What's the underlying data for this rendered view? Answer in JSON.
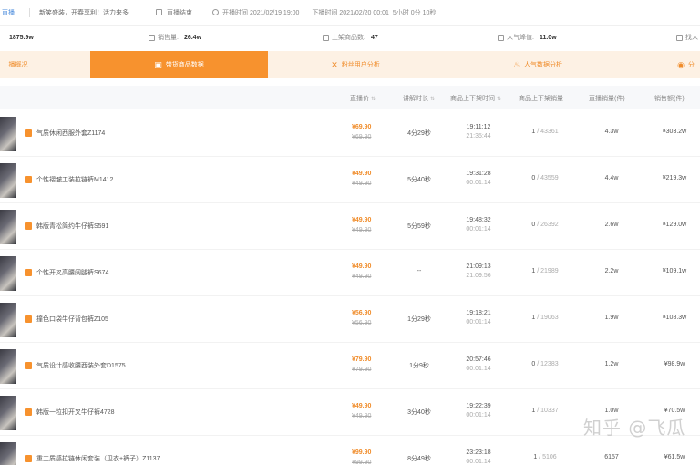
{
  "topbar": {
    "crumb": "直播",
    "slogan": "新笑盛装，开春享利！活力来多",
    "status_label": "直播结束",
    "start_time": "开播时间 2021/02/19 19:00",
    "end_time": "下播时间 2021/02/20 00:01",
    "duration": "5小时 0分 10秒"
  },
  "stats": [
    {
      "label": "",
      "value": "1875.9w"
    },
    {
      "label": "销售量:",
      "value": "26.4w"
    },
    {
      "label": "上架商品数:",
      "value": "47"
    },
    {
      "label": "人气峰值:",
      "value": "11.0w"
    },
    {
      "label": "找人",
      "value": ""
    }
  ],
  "tabs": [
    {
      "label": "播概况",
      "icon": "chart-icon"
    },
    {
      "label": "带货商品数据",
      "icon": "bag-icon"
    },
    {
      "label": "粉丝用户分析",
      "icon": "users-icon"
    },
    {
      "label": "人气数据分析",
      "icon": "fire-icon"
    },
    {
      "label": "分",
      "icon": "coin-icon"
    }
  ],
  "table": {
    "headers": [
      "直播价",
      "讲解时长",
      "商品上下架时间",
      "商品上下架销量",
      "直播销量(件)",
      "销售额(件)"
    ],
    "rows": [
      {
        "name": "气质休闲西服外套Z1174",
        "price": "¥69.90",
        "orig": "¥69.90",
        "dur": "4分29秒",
        "t1": "19:11:12",
        "t2": "21:35:44",
        "rank_a": "1",
        "rank_b": "/ 43361",
        "amt": "4.3w",
        "gmv": "¥303.2w"
      },
      {
        "name": "个性褶皱工装拉链裤M1412",
        "price": "¥49.90",
        "orig": "¥49.90",
        "dur": "5分40秒",
        "t1": "19:31:28",
        "t2": "00:01:14",
        "rank_a": "0",
        "rank_b": "/ 43559",
        "amt": "4.4w",
        "gmv": "¥219.3w"
      },
      {
        "name": "韩版青松简约牛仔裤S591",
        "price": "¥49.90",
        "orig": "¥49.90",
        "dur": "5分59秒",
        "t1": "19:48:32",
        "t2": "00:01:14",
        "rank_a": "0",
        "rank_b": "/ 26392",
        "amt": "2.6w",
        "gmv": "¥129.0w"
      },
      {
        "name": "个性开叉高腰阔腿裤S674",
        "price": "¥49.90",
        "orig": "¥49.90",
        "dur": "--",
        "t1": "21:09:13",
        "t2": "21:09:56",
        "rank_a": "1",
        "rank_b": "/ 21989",
        "amt": "2.2w",
        "gmv": "¥109.1w"
      },
      {
        "name": "撞色口袋牛仔背包裤Z105",
        "price": "¥56.90",
        "orig": "¥56.90",
        "dur": "1分29秒",
        "t1": "19:18:21",
        "t2": "00:01:14",
        "rank_a": "1",
        "rank_b": "/ 19063",
        "amt": "1.9w",
        "gmv": "¥108.3w"
      },
      {
        "name": "气质设计感收腰西装外套D1575",
        "price": "¥79.90",
        "orig": "¥79.90",
        "dur": "1分9秒",
        "t1": "20:57:46",
        "t2": "00:01:14",
        "rank_a": "0",
        "rank_b": "/ 12383",
        "amt": "1.2w",
        "gmv": "¥98.9w"
      },
      {
        "name": "韩版一粒扣开叉牛仔裤4728",
        "price": "¥49.90",
        "orig": "¥49.90",
        "dur": "3分40秒",
        "t1": "19:22:39",
        "t2": "00:01:14",
        "rank_a": "1",
        "rank_b": "/ 10337",
        "amt": "1.0w",
        "gmv": "¥70.5w"
      },
      {
        "name": "重工质感拉链休闲套装（卫衣+裤子）Z1137",
        "price": "¥99.90",
        "orig": "¥99.90",
        "dur": "8分49秒",
        "t1": "23:23:18",
        "t2": "00:01:14",
        "rank_a": "1",
        "rank_b": "/ 5106",
        "amt": "6157",
        "gmv": "¥61.5w"
      }
    ]
  },
  "watermark": "知乎 @飞瓜",
  "colors": {
    "accent": "#f7922e",
    "tab_bg": "#fdf1e4",
    "link": "#4a8bdc"
  }
}
